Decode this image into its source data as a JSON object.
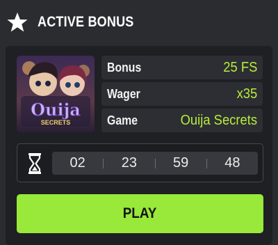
{
  "header": {
    "title": "ACTIVE BONUS",
    "icon": "star-icon"
  },
  "game_thumbnail": {
    "logo_text": "Ouija",
    "logo_subtext": "SECRETS"
  },
  "details": [
    {
      "label": "Bonus",
      "value": "25 FS"
    },
    {
      "label": "Wager",
      "value": "x35"
    },
    {
      "label": "Game",
      "value": "Ouija Secrets"
    }
  ],
  "timer": {
    "icon": "hourglass-icon",
    "segments": [
      "02",
      "23",
      "59",
      "48"
    ]
  },
  "play_button": {
    "label": "PLAY"
  },
  "colors": {
    "accent": "#98e93a",
    "value_text": "#b7ee3c",
    "background": "#2b2c2f",
    "card": "#1f2023"
  }
}
